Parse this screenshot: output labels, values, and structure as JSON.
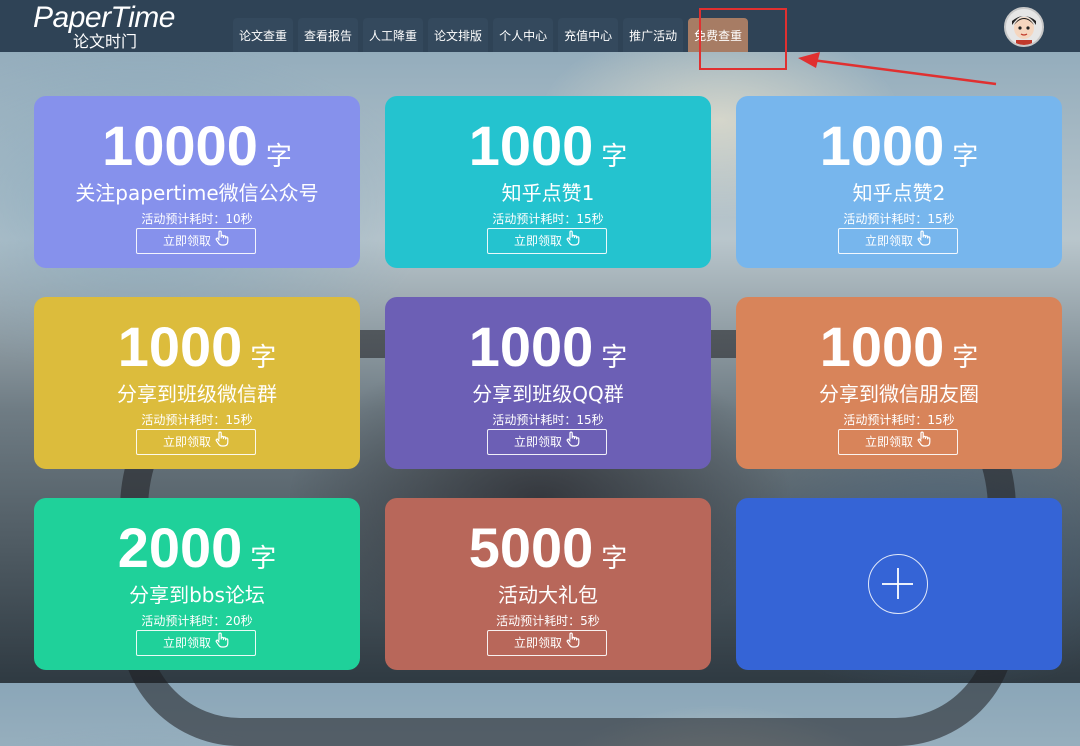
{
  "logo": {
    "main": "PaperTime",
    "sub": "论文时门"
  },
  "nav": [
    {
      "label": "论文查重"
    },
    {
      "label": "查看报告"
    },
    {
      "label": "人工降重"
    },
    {
      "label": "论文排版"
    },
    {
      "label": "个人中心"
    },
    {
      "label": "充值中心"
    },
    {
      "label": "推广活动"
    },
    {
      "label": "免费查重",
      "active": true
    }
  ],
  "cards": [
    {
      "amount": "10000",
      "unit": "字",
      "task": "关注papertime微信公众号",
      "estimate": "活动预计耗时：10秒",
      "button": "立即领取",
      "color": "#8691ec"
    },
    {
      "amount": "1000",
      "unit": "字",
      "task": "知乎点赞1",
      "estimate": "活动预计耗时：15秒",
      "button": "立即领取",
      "color": "#24c3cf"
    },
    {
      "amount": "1000",
      "unit": "字",
      "task": "知乎点赞2",
      "estimate": "活动预计耗时：15秒",
      "button": "立即领取",
      "color": "#77b6ed"
    },
    {
      "amount": "1000",
      "unit": "字",
      "task": "分享到班级微信群",
      "estimate": "活动预计耗时：15秒",
      "button": "立即领取",
      "color": "#dcbc3c"
    },
    {
      "amount": "1000",
      "unit": "字",
      "task": "分享到班级QQ群",
      "estimate": "活动预计耗时：15秒",
      "button": "立即领取",
      "color": "#6c5fb5"
    },
    {
      "amount": "1000",
      "unit": "字",
      "task": "分享到微信朋友圈",
      "estimate": "活动预计耗时：15秒",
      "button": "立即领取",
      "color": "#d8845a"
    },
    {
      "amount": "2000",
      "unit": "字",
      "task": "分享到bbs论坛",
      "estimate": "活动预计耗时：20秒",
      "button": "立即领取",
      "color": "#1fd19a"
    },
    {
      "amount": "5000",
      "unit": "字",
      "task": "活动大礼包",
      "estimate": "活动预计耗时：5秒",
      "button": "立即领取",
      "color": "#b8675a"
    }
  ],
  "add_card": {
    "color": "#3564d6",
    "icon": "plus-icon"
  },
  "highlight_color": "#e03030"
}
